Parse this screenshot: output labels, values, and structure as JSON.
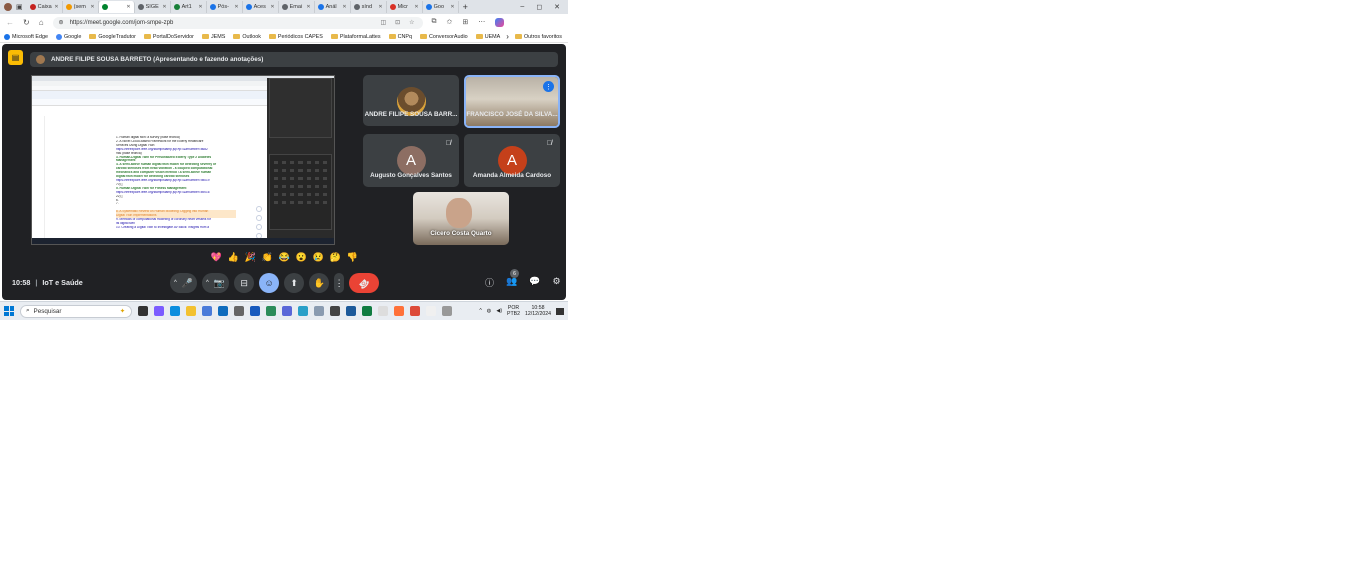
{
  "browser": {
    "tabs": [
      {
        "label": "Caixa",
        "icon": "mail-icon",
        "color": "#c5221f"
      },
      {
        "label": "(sem",
        "icon": "doc-icon",
        "color": "#f29900"
      },
      {
        "label": "",
        "icon": "meet-icon",
        "color": "#00832d",
        "active": true
      },
      {
        "label": "SIGE",
        "icon": "page-icon",
        "color": "#5f6368"
      },
      {
        "label": "Art1",
        "icon": "link-icon",
        "color": "#188038"
      },
      {
        "label": "Pós-",
        "icon": "globe-icon",
        "color": "#1a73e8"
      },
      {
        "label": "Aces",
        "icon": "globe-icon",
        "color": "#1a73e8"
      },
      {
        "label": "Emai",
        "icon": "mail-icon",
        "color": "#5f6368"
      },
      {
        "label": "Anál",
        "icon": "doc-icon",
        "color": "#1a73e8"
      },
      {
        "label": "sínd",
        "icon": "page-icon",
        "color": "#5f6368"
      },
      {
        "label": "Micr",
        "icon": "globe-icon",
        "color": "#d93025"
      },
      {
        "label": "Goo",
        "icon": "search-icon",
        "color": "#1a73e8"
      }
    ],
    "new_tab": "+",
    "window_controls": {
      "minimize": "–",
      "maximize": "◻",
      "close": "✕"
    },
    "nav": {
      "back": "←",
      "refresh": "↻",
      "home": "⌂"
    },
    "url": "https://meet.google.com/jom-smpe-zpb",
    "bookmarks": [
      {
        "label": "Microsoft Edge",
        "type": "site",
        "color": "#1a73e8"
      },
      {
        "label": "Google",
        "type": "site",
        "color": "#4285f4"
      },
      {
        "label": "GoogleTradutor",
        "type": "folder"
      },
      {
        "label": "PortalDoServidor",
        "type": "folder"
      },
      {
        "label": "JEMS",
        "type": "folder"
      },
      {
        "label": "Outlook",
        "type": "folder"
      },
      {
        "label": "Periódicos CAPES",
        "type": "folder"
      },
      {
        "label": "PlataformaLattes",
        "type": "folder"
      },
      {
        "label": "CNPq",
        "type": "folder"
      },
      {
        "label": "ConversorAudio",
        "type": "folder"
      },
      {
        "label": "UEMA",
        "type": "folder"
      }
    ],
    "more_bookmarks": "›",
    "other_favorites": "Outros favoritos"
  },
  "meet": {
    "presenter_banner": "ANDRE FILIPE SOUSA BARRETO (Apresentando e fazendo anotações)",
    "shared_doc": {
      "lines": [
        {
          "text": "1.  Human digital twin: a survey (base teórica)",
          "style": "k"
        },
        {
          "text": "2.  A Novel Cloud-Based Framework for the Elderly Healthcare",
          "style": "k"
        },
        {
          "text": "     Services Using Digital Twin",
          "style": "k"
        },
        {
          "text": "     https://ieeexplore.ieee.org/stamp/stamp.jsp?tp=&arnumber=8682",
          "style": "b"
        },
        {
          "text": "     966 (base teórica)",
          "style": "k"
        },
        {
          "text": "3.  Human-Digital Twin for Personalized Elderly Type 2 Diabetes",
          "style": "g"
        },
        {
          "text": "     Management",
          "style": "g"
        },
        {
          "text": "4.  A semi-active human digital twin model for detecting severity of",
          "style": "g"
        },
        {
          "text": "     carotid stenoses from head vibration - a coupled computational",
          "style": "g"
        },
        {
          "text": "     mechanics and computer vision method / A semi-active human",
          "style": "g"
        },
        {
          "text": "     digital twin model for detecting carotid stenoses",
          "style": "g"
        },
        {
          "text": "     https://ieeexplore.ieee.org/stamp/stamp.jsp?tp=&arnumber=98019",
          "style": "b"
        },
        {
          "text": "     70) ]",
          "style": "k"
        },
        {
          "text": "5.  Human Digital Twin for Fitness Management",
          "style": "g"
        },
        {
          "text": "     https://ieeexplore.ieee.org/stamp/stamp.jsp?tp=&arnumber=89016",
          "style": "b"
        },
        {
          "text": "     22) ]",
          "style": "k"
        },
        {
          "text": "6.",
          "style": "k"
        },
        {
          "text": "7.",
          "style": "k"
        },
        {
          "text": "",
          "style": "k"
        },
        {
          "text": "8.  A Systematic Review on Human Modeling: Digging into Human",
          "style": "o"
        },
        {
          "text": "     Digital Twin Implementations",
          "style": "o"
        },
        {
          "text": "9.  Methods of computational modeling of coronary heart vessels for",
          "style": "b"
        },
        {
          "text": "     its digital twin",
          "style": "b"
        },
        {
          "text": "10.  Creating a Digital Twin to Investigate AV Block: Insights from a",
          "style": "b"
        }
      ]
    },
    "participants": [
      {
        "name": "ANDRE FILIPE SOUSA BARR...",
        "avatar": "photo",
        "muted": false
      },
      {
        "name": "FRANCISCO JOSÉ DA SILVA...",
        "avatar": "video",
        "speaking": true
      },
      {
        "name": "Augusto Gonçalves Santos",
        "avatar_letter": "A",
        "avatar_color": "#8d6e63",
        "muted": true
      },
      {
        "name": "Amanda Almeida Cardoso",
        "avatar_letter": "A",
        "avatar_color": "#c5401a",
        "muted": true
      },
      {
        "name": "Cicero Costa Quarto",
        "avatar": "video",
        "muted": false
      }
    ],
    "reactions": [
      "💖",
      "👍",
      "🎉",
      "👏",
      "😂",
      "😮",
      "😢",
      "🤔",
      "👎"
    ],
    "time": "10:58",
    "separator": "|",
    "meeting_name": "IoT e Saúde",
    "participant_count": "6",
    "controls": {
      "mic": "🎤",
      "camera": "📷",
      "captions": "⊟",
      "emoji": "☺",
      "present": "⬆",
      "raise_hand": "✋",
      "more": "⋮",
      "leave": "☎",
      "expand": "^"
    },
    "right_controls": {
      "info": "ⓘ",
      "people": "👥",
      "chat": "💬",
      "activities": "⚙"
    }
  },
  "taskbar": {
    "search_placeholder": "Pesquisar",
    "language": "POR",
    "layout": "PTB2",
    "clock_time": "10:58",
    "clock_date": "12/12/2024",
    "app_icons": [
      {
        "name": "task-view-icon",
        "color": "#333333"
      },
      {
        "name": "copilot-icon",
        "color": "#7b5cff"
      },
      {
        "name": "edge-icon",
        "color": "#0c8ede"
      },
      {
        "name": "file-explorer-icon",
        "color": "#f3c12f"
      },
      {
        "name": "store-icon",
        "color": "#4a7bd9"
      },
      {
        "name": "outlook-icon",
        "color": "#0f6cbd"
      },
      {
        "name": "settings-icon",
        "color": "#666666"
      },
      {
        "name": "word-icon",
        "color": "#185abd"
      },
      {
        "name": "pen-icon",
        "color": "#2c8c5a"
      },
      {
        "name": "app-icon",
        "color": "#5a67d8"
      },
      {
        "name": "app-icon-2",
        "color": "#2aa0c8"
      },
      {
        "name": "app-icon-3",
        "color": "#8a9bb0"
      },
      {
        "name": "app-icon-4",
        "color": "#444444"
      },
      {
        "name": "app-icon-5",
        "color": "#1d5a9a"
      },
      {
        "name": "excel-icon",
        "color": "#107c41"
      },
      {
        "name": "notes-icon",
        "color": "#dddddd"
      },
      {
        "name": "firefox-icon",
        "color": "#ff7139"
      },
      {
        "name": "chrome-icon",
        "color": "#dd4b39"
      },
      {
        "name": "doc-app-icon",
        "color": "#f0f0f0"
      },
      {
        "name": "window-icon",
        "color": "#999999"
      }
    ]
  }
}
